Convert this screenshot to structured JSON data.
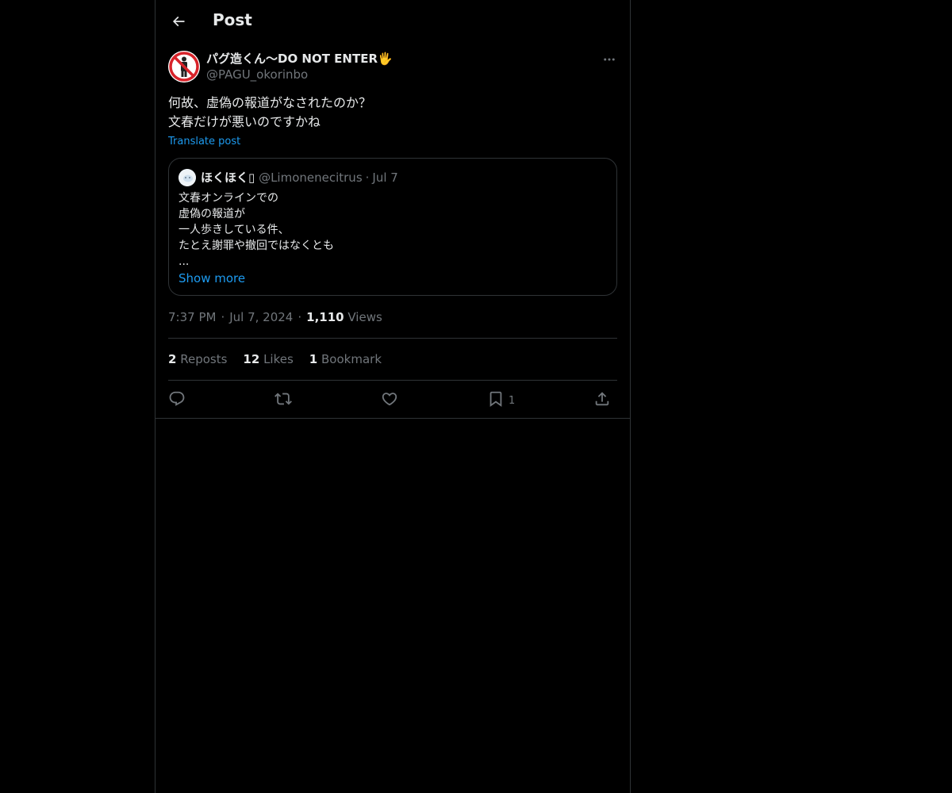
{
  "header": {
    "title": "Post",
    "back_icon": "arrow-left-icon"
  },
  "post": {
    "author": {
      "name": "パグ造くん〜DO NOT ENTER🖐",
      "handle": "@PAGU_okorinbo",
      "avatar_icon": "no-entry-person-icon"
    },
    "more_icon": "ellipsis-icon",
    "text_lines": [
      "何故、虚偽の報道がなされたのか？",
      "文春だけが悪いのですかね"
    ],
    "translate_label": "Translate post",
    "quote": {
      "name": "ほくほく",
      "handle": "@Limonenecitrus",
      "separator": "·",
      "date": "Jul 7",
      "text_lines": [
        "文春オンラインでの",
        "虚偽の報道が",
        "一人歩きしている件、",
        "たとえ謝罪や撤回ではなくとも",
        "..."
      ],
      "show_more": "Show more"
    },
    "time": "7:37 PM",
    "separator": "·",
    "date": "Jul 7, 2024",
    "views_count": "1,110",
    "views_label": "Views",
    "stats": {
      "reposts_count": "2",
      "reposts_label": "Reposts",
      "likes_count": "12",
      "likes_label": "Likes",
      "bookmarks_count": "1",
      "bookmarks_label": "Bookmark"
    },
    "actions": {
      "reply_icon": "reply-icon",
      "repost_icon": "repost-icon",
      "like_icon": "heart-icon",
      "bookmark_icon": "bookmark-icon",
      "bookmark_count": "1",
      "share_icon": "share-icon"
    }
  },
  "colors": {
    "background": "#000000",
    "text": "#e7e9ea",
    "secondary": "#71767b",
    "accent": "#1d9bf0",
    "border": "#2f3336"
  }
}
